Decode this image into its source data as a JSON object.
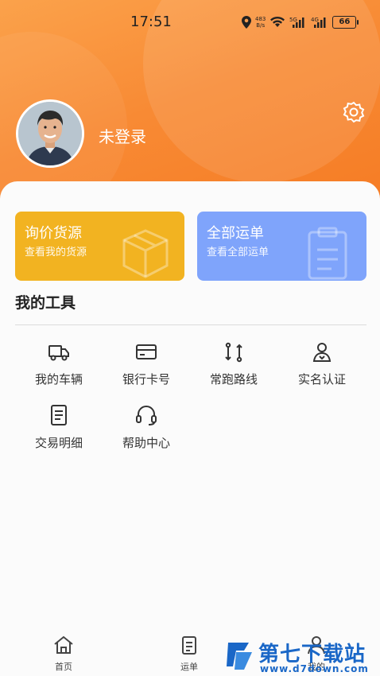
{
  "status": {
    "time": "17:51",
    "net_speed_value": "483",
    "net_speed_unit": "B/s",
    "battery": "66"
  },
  "profile": {
    "login_text": "未登录"
  },
  "quick_cards": [
    {
      "title": "询价货源",
      "subtitle": "查看我的货源",
      "color": "#f2b321"
    },
    {
      "title": "全部运单",
      "subtitle": "查看全部运单",
      "color": "#7fa4fb"
    }
  ],
  "tools": {
    "section_title": "我的工具",
    "items": [
      {
        "label": "我的车辆",
        "icon": "truck-icon"
      },
      {
        "label": "银行卡号",
        "icon": "bank-card-icon"
      },
      {
        "label": "常跑路线",
        "icon": "route-icon"
      },
      {
        "label": "实名认证",
        "icon": "user-verify-icon"
      },
      {
        "label": "交易明细",
        "icon": "transaction-document-icon"
      },
      {
        "label": "帮助中心",
        "icon": "headset-icon"
      }
    ]
  },
  "tabbar": {
    "items": [
      {
        "label": "首页",
        "icon": "home-icon"
      },
      {
        "label": "运单",
        "icon": "waybill-icon"
      },
      {
        "label": "我的",
        "icon": "profile-icon"
      }
    ]
  },
  "watermark": {
    "text": "第七下载站",
    "url": "www.d7down.com"
  },
  "colors": {
    "header_orange": "#f88a34",
    "card_yellow": "#f2b321",
    "card_blue": "#7fa4fb",
    "watermark_blue": "#1a67c7"
  }
}
